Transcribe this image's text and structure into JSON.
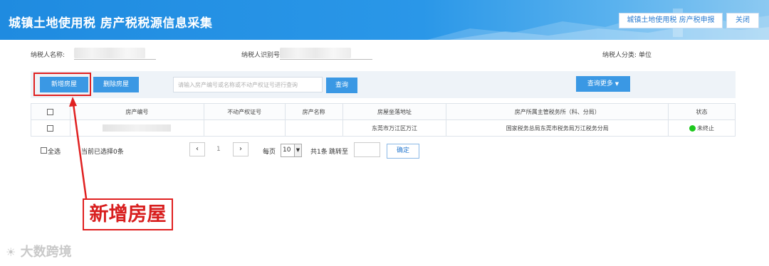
{
  "header": {
    "title": "城镇土地使用税 房产税税源信息采集",
    "report_button": "城镇土地使用税 房产税申报",
    "close_button": "关闭"
  },
  "taxpayer": {
    "name_label": "纳税人名称:",
    "id_label": "纳税人识别号",
    "category_label": "纳税人分类:",
    "category_value": "单位"
  },
  "toolbar": {
    "add_label": "新增房屋",
    "delete_label": "删除房屋",
    "search_placeholder": "请输入房产编号或名称或不动产权证号进行查询",
    "query_label": "查询",
    "more_label": "查询更多"
  },
  "table": {
    "headers": [
      "房产编号",
      "不动产权证号",
      "房产名称",
      "房屋坐落地址",
      "房产所属主管税务所（科、分局）",
      "状态"
    ],
    "rows": [
      {
        "property_no": "",
        "cert_no": "",
        "name": "",
        "address": "东莞市万江区万江",
        "tax_office": "国家税务总局东莞市税务局万江税务分局",
        "status": "未终止",
        "status_color": "#1ec81e"
      }
    ]
  },
  "pager": {
    "select_all": "全选",
    "selected_text": "当前已选择0条",
    "current_page": "1",
    "per_page_label": "每页",
    "per_page_value": "10",
    "total_text": "共1条",
    "jump_label": "跳转至",
    "confirm_label": "确定"
  },
  "annotation": {
    "label": "新增房屋",
    "color": "#e02020"
  },
  "watermark": "大数跨境"
}
